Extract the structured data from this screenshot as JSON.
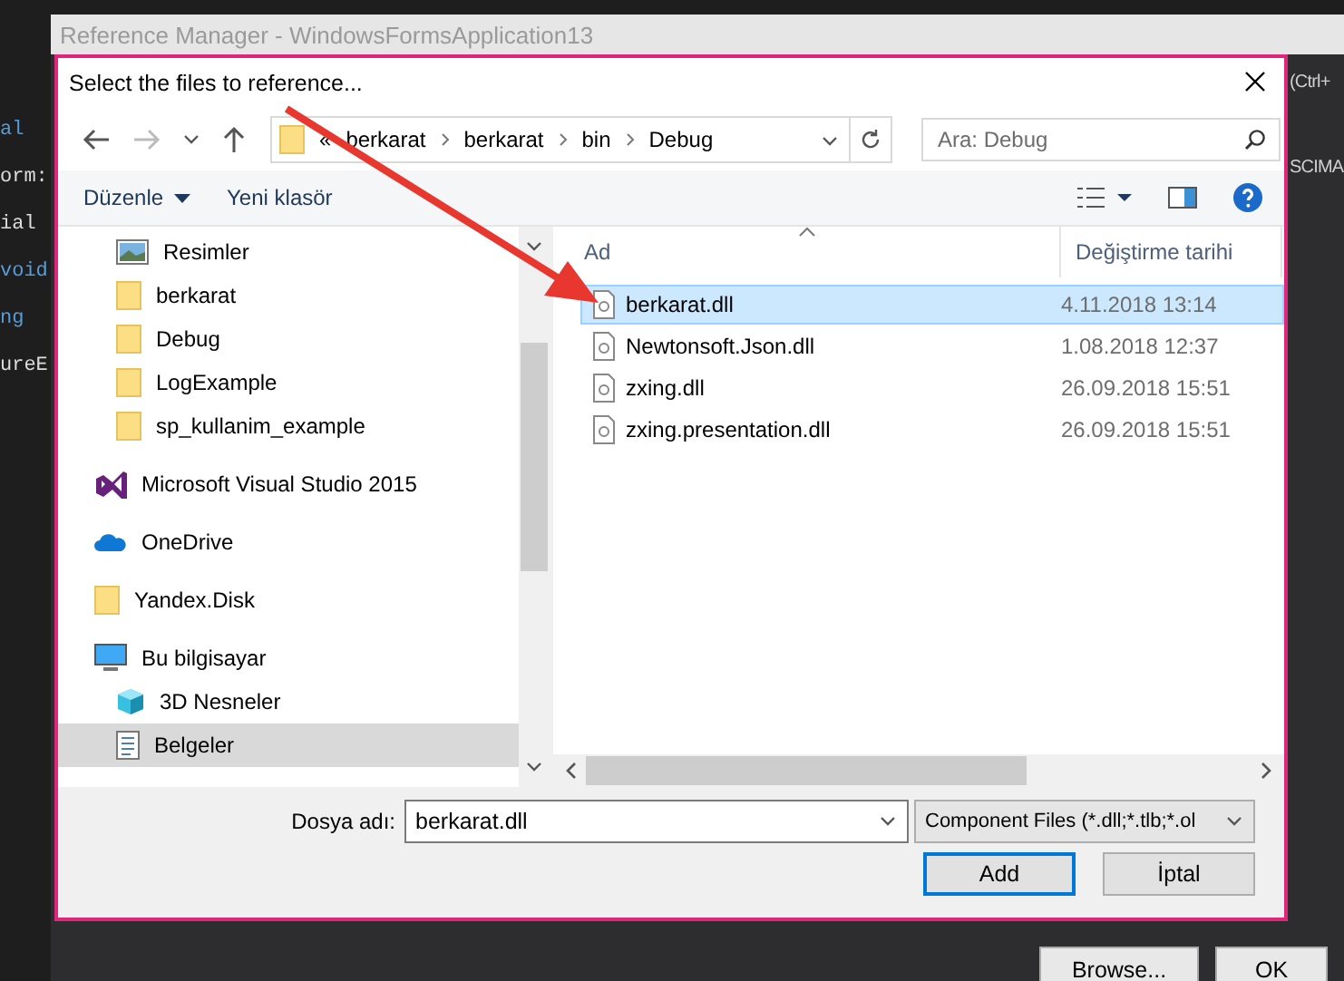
{
  "background_code": [
    {
      "text": "al",
      "kind": "keyword"
    },
    {
      "text": "orm:",
      "kind": "plain"
    },
    {
      "text": "ial",
      "kind": "plain"
    },
    {
      "text": "void",
      "kind": "keyword"
    },
    {
      "text": "ng",
      "kind": "keyword"
    },
    {
      "text": "ureE",
      "kind": "plain"
    }
  ],
  "background_right": [
    "(Ctrl+",
    "SCIMA"
  ],
  "window": {
    "title": "Reference Manager - WindowsFormsApplication13",
    "buttons": [
      "Browse...",
      "OK"
    ]
  },
  "dialog": {
    "title": "Select the files to reference...",
    "address": {
      "overflow": "«",
      "path": [
        "berkarat",
        "berkarat",
        "bin",
        "Debug"
      ]
    },
    "search": {
      "placeholder": "Ara: Debug"
    },
    "toolbar": {
      "organize": "Düzenle",
      "new_folder": "Yeni klasör"
    },
    "sidebar": {
      "pinned_items": [
        {
          "label": "Resimler",
          "kind": "pictures",
          "selected": false
        },
        {
          "label": "berkarat",
          "kind": "folder",
          "selected": false
        },
        {
          "label": "Debug",
          "kind": "folder",
          "selected": false
        },
        {
          "label": "LogExample",
          "kind": "folder",
          "selected": false
        },
        {
          "label": "sp_kullanim_example",
          "kind": "folder",
          "selected": false
        }
      ],
      "items": [
        {
          "label": "Microsoft Visual Studio 2015",
          "kind": "visual-studio",
          "selected": false
        },
        {
          "label": "OneDrive",
          "kind": "onedrive",
          "selected": false
        },
        {
          "label": "Yandex.Disk",
          "kind": "folder",
          "selected": false
        },
        {
          "label": "Bu bilgisayar",
          "kind": "computer",
          "selected": false,
          "children": [
            {
              "label": "3D Nesneler",
              "kind": "objects",
              "selected": false
            },
            {
              "label": "Belgeler",
              "kind": "documents",
              "selected": true
            }
          ]
        }
      ]
    },
    "table": {
      "columns": [
        "Ad",
        "Değiştirme tarihi"
      ],
      "rows": [
        {
          "cells": [
            "berkarat.dll",
            "4.11.2018 13:14"
          ],
          "selected": true
        },
        {
          "cells": [
            "Newtonsoft.Json.dll",
            "1.08.2018 12:37"
          ],
          "selected": false
        },
        {
          "cells": [
            "zxing.dll",
            "26.09.2018 15:51"
          ],
          "selected": false
        },
        {
          "cells": [
            "zxing.presentation.dll",
            "26.09.2018 15:51"
          ],
          "selected": false
        }
      ]
    },
    "file_name": {
      "label": "Dosya adı:",
      "value": "berkarat.dll"
    },
    "filter": {
      "value": "Component Files (*.dll;*.tlb;*.ol"
    },
    "buttons": [
      {
        "label": "Add",
        "default": true
      },
      {
        "label": "İptal",
        "default": false
      }
    ]
  }
}
